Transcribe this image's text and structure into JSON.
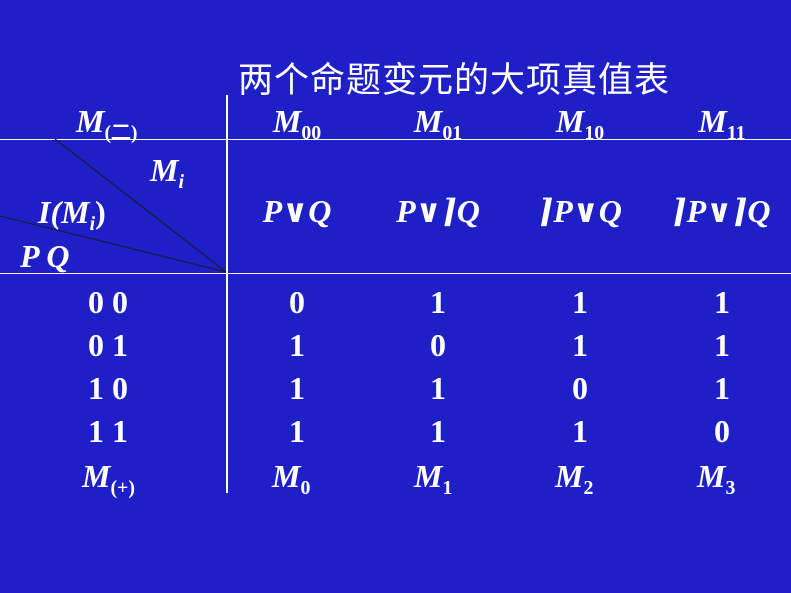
{
  "title": "两个命题变元的大项真值表",
  "corner": {
    "m_conj_base": "M",
    "m_conj_sub": "(二)",
    "mi_base": "M",
    "mi_sub": "i",
    "i_label": "I(",
    "i_m": "M",
    "i_sub": "i",
    "i_close": ")",
    "pq": "P Q"
  },
  "columns": [
    {
      "base": "M",
      "sub": "00",
      "formula": "P∨Q"
    },
    {
      "base": "M",
      "sub": "01",
      "formula": "P∨⌉Q"
    },
    {
      "base": "M",
      "sub": "10",
      "formula": "⌉P∨Q"
    },
    {
      "base": "M",
      "sub": "11",
      "formula": "⌉P∨⌉Q"
    }
  ],
  "rows": [
    {
      "assignment": "0 0",
      "values": [
        "0",
        "1",
        "1",
        "1"
      ]
    },
    {
      "assignment": "0 1",
      "values": [
        "1",
        "0",
        "1",
        "1"
      ]
    },
    {
      "assignment": "1 0",
      "values": [
        "1",
        "1",
        "0",
        "1"
      ]
    },
    {
      "assignment": "1 1",
      "values": [
        "1",
        "1",
        "1",
        "0"
      ]
    }
  ],
  "footer": {
    "label_base": "M",
    "label_sub": "(+)",
    "cells": [
      {
        "base": "M",
        "sub": "0"
      },
      {
        "base": "M",
        "sub": "1"
      },
      {
        "base": "M",
        "sub": "2"
      },
      {
        "base": "M",
        "sub": "3"
      }
    ]
  },
  "colors": {
    "background": "#1f1fc8",
    "text": "#ffffff"
  }
}
